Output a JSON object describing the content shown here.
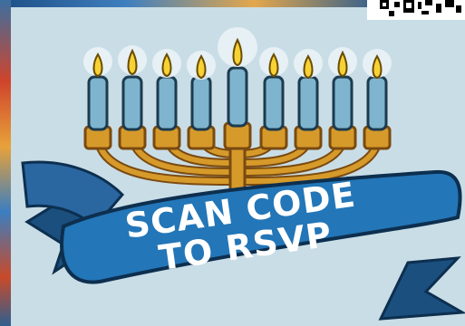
{
  "banner": {
    "line1": "SCAN CODE",
    "line2": "TO RSVP"
  },
  "colors": {
    "background": "#c9dde6",
    "banner": "#2376b7",
    "banner_dark": "#1a4f7e",
    "candle": "#7fb4cf",
    "menorah_gold": "#d69a2a",
    "flame": "#f6d235"
  },
  "icons": [
    "qr-code-icon",
    "menorah-icon",
    "flame-icon"
  ]
}
